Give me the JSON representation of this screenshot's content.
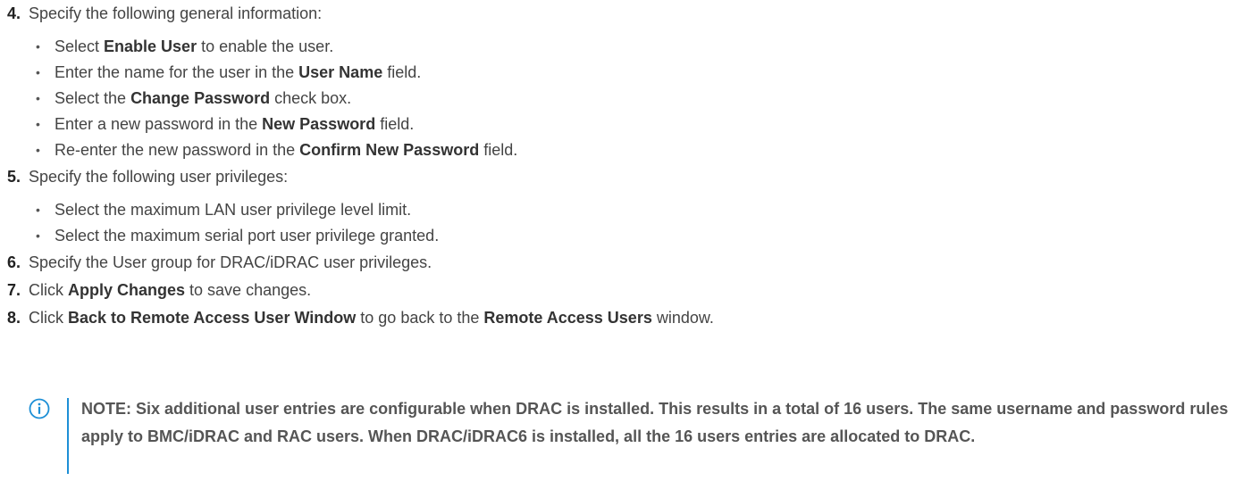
{
  "steps": {
    "s4": {
      "num": "4.",
      "text": "Specify the following general information:",
      "items": [
        {
          "pre": "Select ",
          "bold": "Enable User",
          "post": " to enable the user."
        },
        {
          "pre": "Enter the name for the user in the ",
          "bold": "User Name",
          "post": " field."
        },
        {
          "pre": "Select the ",
          "bold": "Change Password",
          "post": " check box."
        },
        {
          "pre": "Enter a new password in the ",
          "bold": "New Password",
          "post": " field."
        },
        {
          "pre": "Re-enter the new password in the ",
          "bold": "Confirm New Password",
          "post": " field."
        }
      ]
    },
    "s5": {
      "num": "5.",
      "text": "Specify the following user privileges:",
      "items": [
        {
          "text": "Select the maximum LAN user privilege level limit."
        },
        {
          "text": "Select the maximum serial port user privilege granted."
        }
      ]
    },
    "s6": {
      "num": "6.",
      "text": "Specify the User group for DRAC/iDRAC user privileges."
    },
    "s7": {
      "num": "7.",
      "pre": "Click ",
      "bold": "Apply Changes",
      "post": " to save changes."
    },
    "s8": {
      "num": "8.",
      "pre": "Click ",
      "bold": "Back to Remote Access User Window",
      "mid": " to go back to the ",
      "bold2": "Remote Access Users",
      "post": " window."
    }
  },
  "note": {
    "icon": "info-icon",
    "text": "NOTE: Six additional user entries are configurable when DRAC is installed. This results in a total of 16 users. The same username and password rules apply to BMC/iDRAC and RAC users. When DRAC/iDRAC6 is installed, all the 16 users entries are allocated to DRAC."
  },
  "colors": {
    "text": "#444444",
    "accent": "#1d8fd6"
  }
}
